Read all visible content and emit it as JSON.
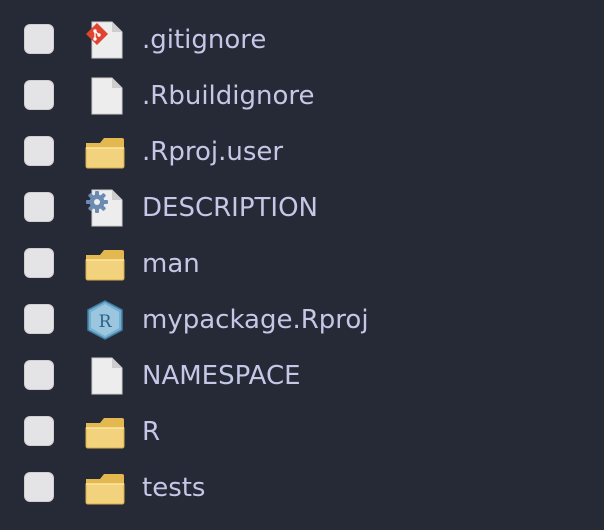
{
  "files": [
    {
      "name": ".gitignore",
      "icon": "git-file-icon"
    },
    {
      "name": ".Rbuildignore",
      "icon": "blank-file-icon"
    },
    {
      "name": ".Rproj.user",
      "icon": "folder-icon"
    },
    {
      "name": "DESCRIPTION",
      "icon": "gear-file-icon"
    },
    {
      "name": "man",
      "icon": "folder-icon"
    },
    {
      "name": "mypackage.Rproj",
      "icon": "r-project-icon"
    },
    {
      "name": "NAMESPACE",
      "icon": "blank-file-icon"
    },
    {
      "name": "R",
      "icon": "folder-icon"
    },
    {
      "name": "tests",
      "icon": "folder-icon"
    }
  ],
  "colors": {
    "background": "#262936",
    "text": "#c4c7e6",
    "folder": "#f3d27e",
    "git": "#e0432f",
    "gear": "#6b8bb3",
    "r_project": "#5b9bbf"
  }
}
